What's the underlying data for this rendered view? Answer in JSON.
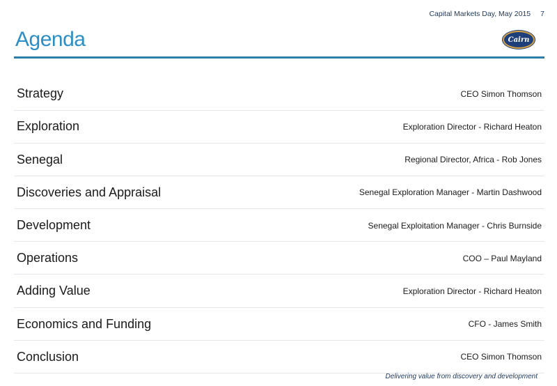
{
  "header": {
    "event": "Capital Markets Day, May 2015",
    "page_number": "7"
  },
  "title": "Agenda",
  "logo": {
    "text": "Cairn",
    "colors": {
      "fill": "#1f3f7a",
      "ring": "#d9a441"
    }
  },
  "agenda": [
    {
      "topic": "Strategy",
      "speaker": "CEO Simon Thomson"
    },
    {
      "topic": "Exploration",
      "speaker": "Exploration Director - Richard Heaton"
    },
    {
      "topic": "Senegal",
      "speaker": "Regional Director, Africa - Rob Jones"
    },
    {
      "topic": "Discoveries and Appraisal",
      "speaker": "Senegal Exploration Manager  - Martin Dashwood"
    },
    {
      "topic": "Development",
      "speaker": "Senegal Exploitation Manager  - Chris Burnside"
    },
    {
      "topic": "Operations",
      "speaker": "COO – Paul Mayland"
    },
    {
      "topic": "Adding Value",
      "speaker": "Exploration Director - Richard Heaton"
    },
    {
      "topic": "Economics and Funding",
      "speaker": "CFO - James Smith"
    },
    {
      "topic": "Conclusion",
      "speaker": "CEO Simon Thomson"
    }
  ],
  "footer": "Delivering value from discovery and development",
  "colors": {
    "title": "#2b8fc6",
    "rule": "#2e7fa8",
    "meta": "#1f3b63"
  }
}
